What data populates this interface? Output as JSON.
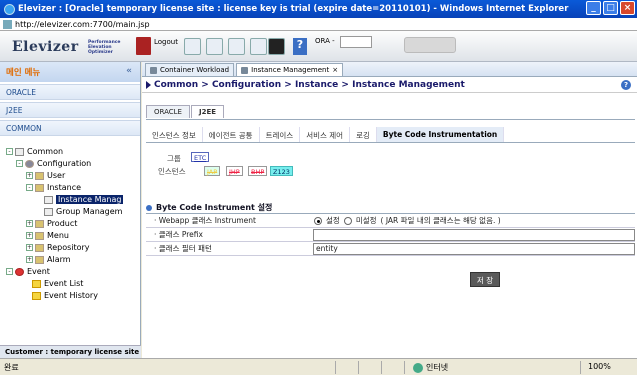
{
  "window": {
    "title": "Elevizer : [Oracle] temporary license site : license key is trial (expire date=20110101) - Windows Internet Explorer",
    "url": "http://elevizer.com:7700/main.jsp"
  },
  "toolbar": {
    "logo": "Elevizer",
    "logo_sub": [
      "Performance",
      "Elevation",
      "Optimizer"
    ],
    "logout_label": "Logout",
    "ora_label": "ORA -",
    "ora_value": ""
  },
  "sidebar": {
    "header": "메인 메뉴",
    "collapse": "«",
    "sections": [
      "ORACLE",
      "J2EE",
      "COMMON"
    ],
    "tree": {
      "common": "Common",
      "configuration": "Configuration",
      "user": "User",
      "instance": "Instance",
      "instance_management": "Instance Manag",
      "group_management": "Group Managem",
      "product": "Product",
      "menu": "Menu",
      "repository": "Repository",
      "alarm": "Alarm",
      "event": "Event",
      "event_list": "Event List",
      "event_history": "Event History"
    },
    "status": "Customer : temporary license site"
  },
  "main": {
    "doc_tabs": [
      "Container Workload",
      "Instance Management"
    ],
    "breadcrumb": "Common > Configuration > Instance > Instance Management",
    "help": "?",
    "db_tabs": [
      "ORACLE",
      "J2EE"
    ],
    "sub_tabs": [
      "인스턴스 정보",
      "에이전트 공통",
      "트레이스",
      "서비스 제어",
      "로깅",
      "Byte Code Instrumentation"
    ],
    "group_label": "그룹",
    "instance_label": "인스턴스",
    "group_tag": "ETC",
    "instance_tags": [
      "JAP",
      "JHP",
      "BHP",
      "Z123"
    ],
    "section_title": "Byte Code Instrument 설정",
    "rows": [
      {
        "label": "Webapp 클래스 Instrument",
        "radio_on": "설정",
        "radio_off": "미설정",
        "note": "( JAR 파일 내의 클래스는 해당 없음. )"
      },
      {
        "label": "클래스 Prefix",
        "value": ""
      },
      {
        "label": "클래스 필터 패턴",
        "value": "entity"
      }
    ],
    "save": "저 장"
  },
  "status": {
    "left": "완료",
    "zone": "인터넷",
    "zoom": "100%"
  }
}
